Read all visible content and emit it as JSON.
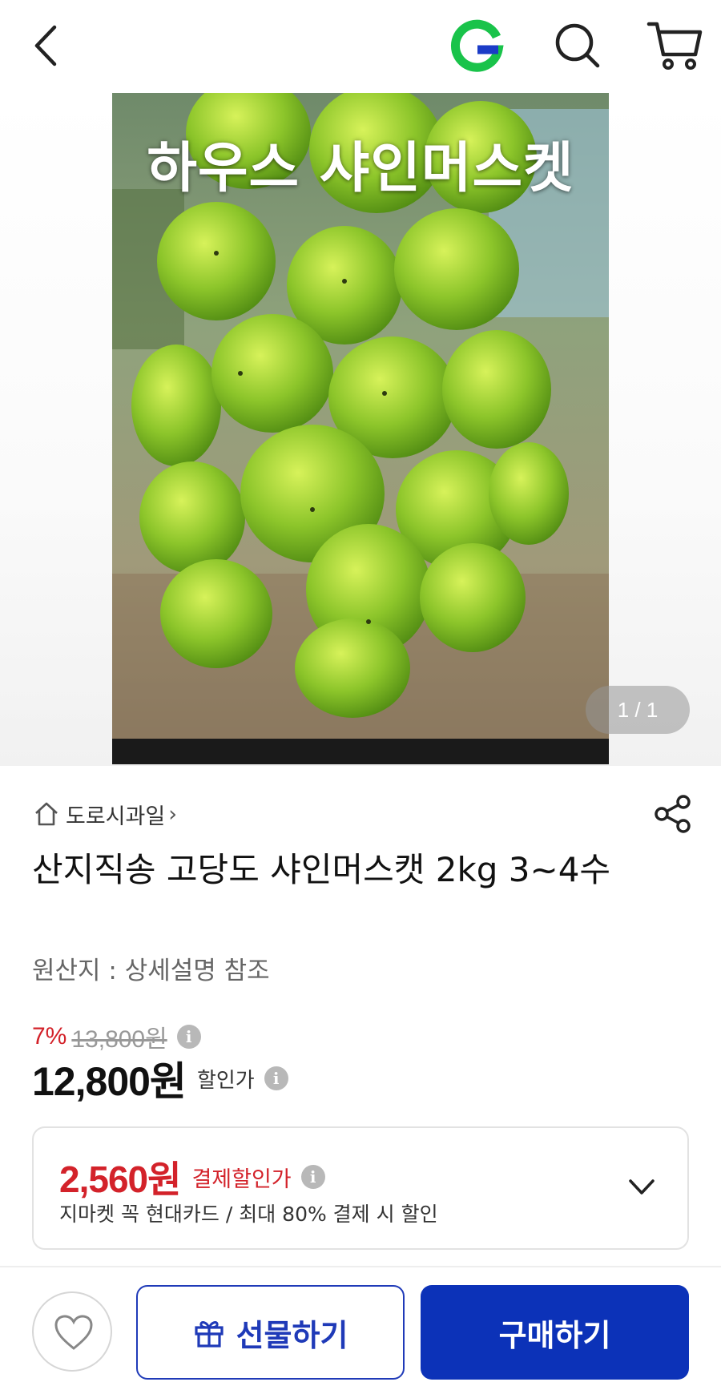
{
  "header": {
    "back_icon": "chevron-left-icon",
    "logo_icon": "gmarket-g-logo",
    "search_icon": "search-icon",
    "cart_icon": "cart-icon",
    "logo_color": "#19c34a"
  },
  "gallery": {
    "caption": "하우스 샤인머스켓",
    "counter": "1 / 1"
  },
  "product": {
    "shop_name": "도로시과일",
    "shop_chevron": "›",
    "title": "산지직송 고당도 샤인머스캣 2kg 3~4수",
    "origin": "원산지 : 상세설명 참조",
    "discount_rate": "7%",
    "original_price": "13,800원",
    "price": "12,800원",
    "price_label": "할인가",
    "info_glyph": "i"
  },
  "payment": {
    "price": "2,560원",
    "label": "결제할인가",
    "description": "지마켓 꼭 현대카드 / 최대 80% 결제 시 할인",
    "accent": "#d3222a"
  },
  "bottom_bar": {
    "gift_label": "선물하기",
    "buy_label": "구매하기",
    "brand_color": "#0c32b8"
  }
}
